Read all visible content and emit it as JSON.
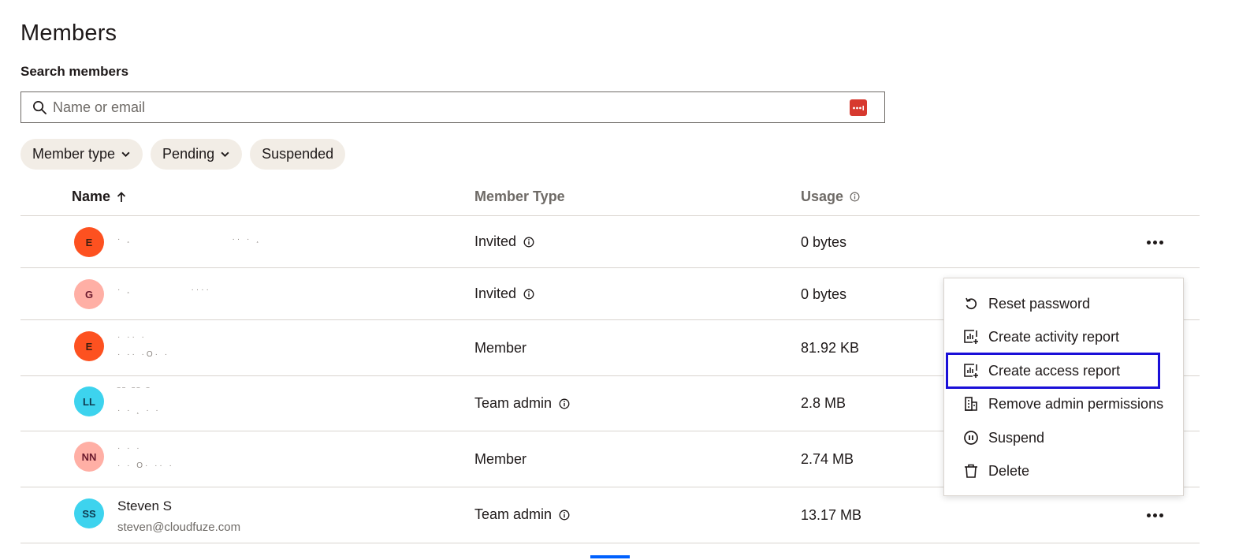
{
  "page": {
    "title": "Members"
  },
  "search": {
    "label": "Search members",
    "placeholder": "Name or email",
    "value": ""
  },
  "filters": [
    {
      "label": "Member type",
      "dropdown": true
    },
    {
      "label": "Pending",
      "dropdown": true
    },
    {
      "label": "Suspended",
      "dropdown": false
    }
  ],
  "table": {
    "headers": {
      "name": "Name",
      "member_type": "Member Type",
      "usage": "Usage"
    },
    "rows": [
      {
        "initials": "E",
        "avatar_bg": "#fd5120",
        "avatar_fg": "#401f10",
        "name": "",
        "email": "",
        "member_type": "Invited",
        "type_info": true,
        "usage": "0 bytes"
      },
      {
        "initials": "G",
        "avatar_bg": "#ffafa5",
        "avatar_fg": "#6b1a2e",
        "name": "",
        "email": "",
        "member_type": "Invited",
        "type_info": true,
        "usage": "0 bytes"
      },
      {
        "initials": "E",
        "avatar_bg": "#fd5120",
        "avatar_fg": "#401f10",
        "name": "",
        "email": "",
        "member_type": "Member",
        "type_info": false,
        "usage": "81.92 KB"
      },
      {
        "initials": "LL",
        "avatar_bg": "#3dd3ee",
        "avatar_fg": "#0e3a4f",
        "name": "",
        "email": "",
        "member_type": "Team admin",
        "type_info": true,
        "usage": "2.8 MB"
      },
      {
        "initials": "NN",
        "avatar_bg": "#ffafa5",
        "avatar_fg": "#6b1a2e",
        "name": "",
        "email": "",
        "member_type": "Member",
        "type_info": false,
        "usage": "2.74 MB"
      },
      {
        "initials": "SS",
        "avatar_bg": "#3dd3ee",
        "avatar_fg": "#0e3a4f",
        "name": "Steven S",
        "email": "steven@cloudfuze.com",
        "member_type": "Team admin",
        "type_info": true,
        "usage": "13.17 MB"
      }
    ]
  },
  "context_menu": {
    "items": [
      {
        "label": "Reset password",
        "icon": "reset-icon"
      },
      {
        "label": "Create activity report",
        "icon": "report-icon"
      },
      {
        "label": "Create access report",
        "icon": "report-icon",
        "highlighted": true
      },
      {
        "label": "Remove admin permissions",
        "icon": "building-icon"
      },
      {
        "label": "Suspend",
        "icon": "pause-icon"
      },
      {
        "label": "Delete",
        "icon": "trash-icon"
      }
    ]
  },
  "colors": {
    "accent": "#0061fe",
    "highlight_box": "#1a0fd8",
    "chip_bg": "#f2ede6",
    "text": "#1e1919",
    "muted": "#6e6a66"
  }
}
